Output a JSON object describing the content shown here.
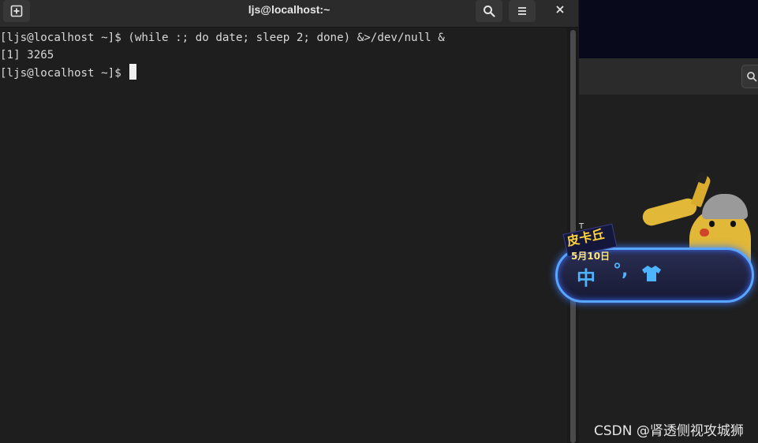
{
  "terminal": {
    "title": "ljs@localhost:~",
    "lines": [
      "[ljs@localhost ~]$ (while :; do date; sleep 2; done) &>/dev/null &",
      "[1] 3265",
      "[ljs@localhost ~]$ "
    ],
    "icons": {
      "new_tab": "new-tab-icon",
      "search": "search-icon",
      "menu": "hamburger-menu-icon",
      "close": "close-icon"
    }
  },
  "ime_widget": {
    "brand": "皮卡丘",
    "date": "5月10日",
    "mode_label": "中",
    "punct_label": "°,",
    "icons": {
      "skin": "shirt-icon",
      "mascot": "pikachu-mascot-icon"
    }
  },
  "right_app": {
    "search_icon": "search-icon"
  },
  "watermark": "CSDN @肾透侧视攻城狮",
  "colors": {
    "terminal_bg": "#1e1e1e",
    "titlebar_bg": "#2b2b2b",
    "text": "#d8d8d8",
    "ime_accent": "#4fb4ff"
  }
}
